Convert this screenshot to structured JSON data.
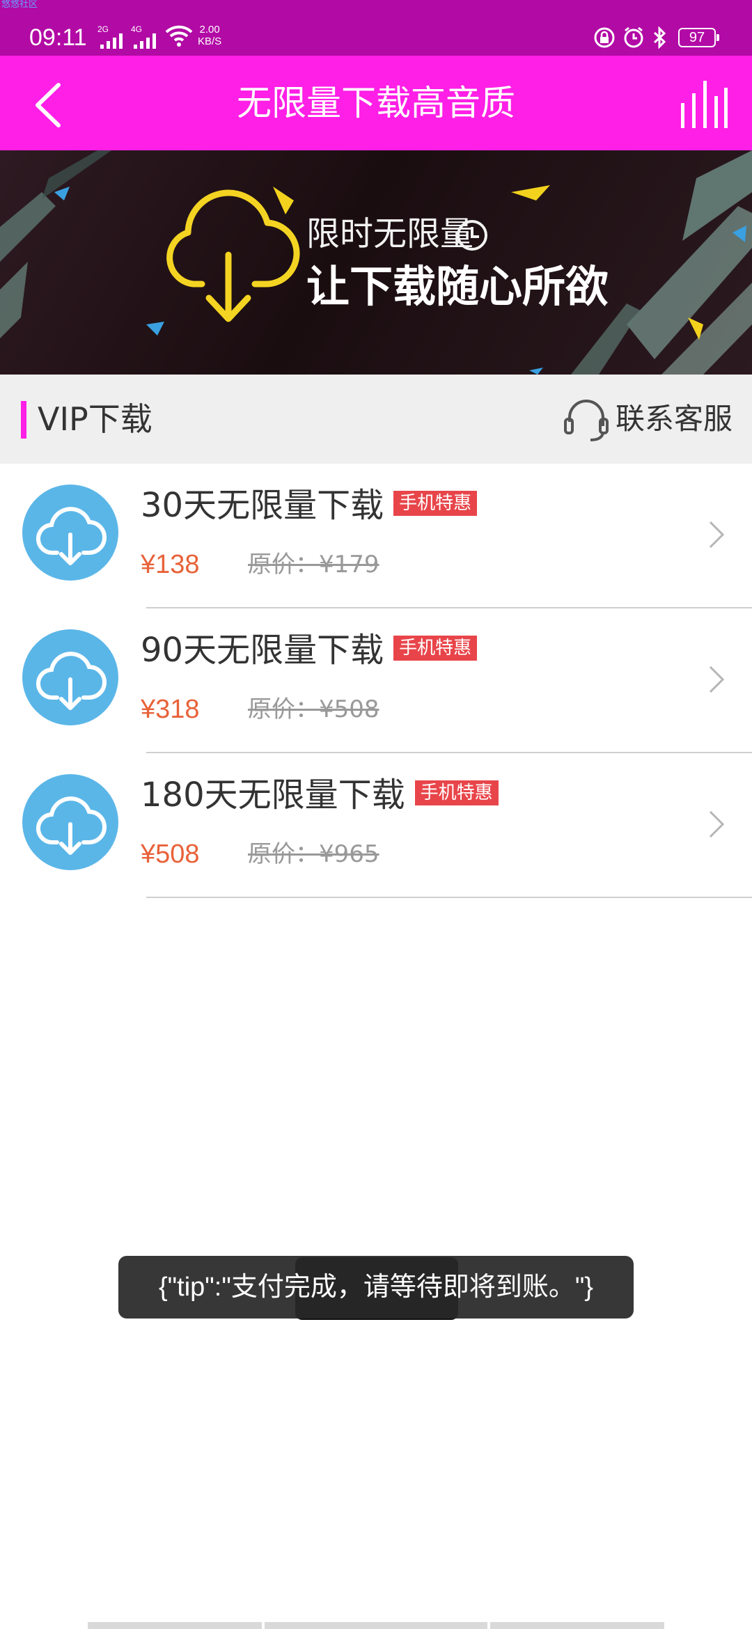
{
  "status_bar": {
    "watermark": "悠悠社区",
    "time": "09:11",
    "signal1_gen": "2G",
    "signal2_gen": "4G",
    "net_speed_value": "2.00",
    "net_speed_unit": "KB/S",
    "battery": "97"
  },
  "header": {
    "title": "无限量下载高音质"
  },
  "banner": {
    "line1": "限时无限量",
    "line2": "让下载随心所欲"
  },
  "section": {
    "title": "VIP下载",
    "service_label": "联系客服"
  },
  "plans": [
    {
      "name": "30天无限量下载",
      "badge": "手机特惠",
      "price": "¥138",
      "original": "原价：¥179"
    },
    {
      "name": "90天无限量下载",
      "badge": "手机特惠",
      "price": "¥318",
      "original": "原价：¥508"
    },
    {
      "name": "180天无限量下载",
      "badge": "手机特惠",
      "price": "¥508",
      "original": "原价：¥965"
    }
  ],
  "toast": {
    "message": "{\"tip\":\"支付完成，请等待即将到账。\"}"
  },
  "colors": {
    "status_bar": "#b20aa5",
    "header": "#ff1fe6",
    "accent": "#ff1fe6",
    "price": "#e8623a",
    "badge": "#e8454a",
    "icon_circle": "#5bb6e8"
  },
  "icons": {
    "back": "back-arrow-icon",
    "equalizer": "equalizer-icon",
    "headset": "headset-icon",
    "download": "cloud-download-icon",
    "chevron": "chevron-right-icon"
  }
}
